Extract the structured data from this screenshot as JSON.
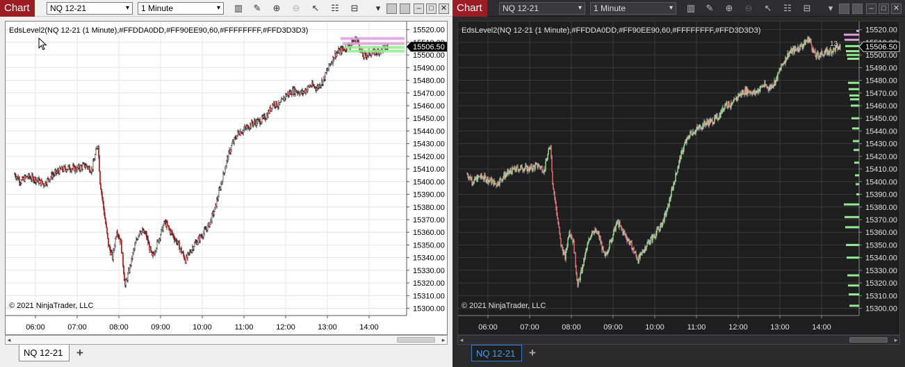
{
  "windows": [
    {
      "id": "light",
      "theme": "light",
      "toolbar": {
        "chart_label": "Chart",
        "instrument": "NQ 12-21",
        "interval": "1 Minute",
        "icons": [
          "bar-type-icon",
          "draw-pencil-icon",
          "zoom-in-icon",
          "zoom-out-icon",
          "pointer-icon",
          "strategies-icon",
          "properties-icon",
          "dropdown-more-icon"
        ]
      },
      "indicator_label": "EdsLevel2(NQ 12-21 (1 Minute),#FFDDA0DD,#FF90EE90,60,#FFFFFFFF,#FFD3D3D3)",
      "copyright": "© 2021 NinjaTrader, LLC",
      "tab_label": "NQ 12-21",
      "add_tab": "+",
      "current_price": "15506.50"
    },
    {
      "id": "dark",
      "theme": "dark",
      "toolbar": {
        "chart_label": "Chart",
        "instrument": "NQ 12-21",
        "interval": "1 Minute"
      },
      "indicator_label": "EdsLevel2(NQ 12-21 (1 Minute),#FFDDA0DD,#FF90EE90,60,#FFFFFFFF,#FFD3D3D3)",
      "copyright": "© 2021 NinjaTrader, LLC",
      "tab_label": "NQ 12-21",
      "add_tab": "+",
      "current_price": "15506.50",
      "volume_label": "13"
    }
  ],
  "chart_data": {
    "type": "candlestick",
    "instrument": "NQ 12-21",
    "interval": "1 Minute",
    "x_ticks": [
      "06:00",
      "07:00",
      "08:00",
      "09:00",
      "10:00",
      "11:00",
      "12:00",
      "13:00",
      "14:00"
    ],
    "y_ticks": [
      "15520.00",
      "15510.00",
      "15500.00",
      "15490.00",
      "15480.00",
      "15470.00",
      "15460.00",
      "15450.00",
      "15440.00",
      "15430.00",
      "15420.00",
      "15410.00",
      "15400.00",
      "15390.00",
      "15380.00",
      "15370.00",
      "15360.00",
      "15350.00",
      "15340.00",
      "15330.00",
      "15320.00",
      "15310.00",
      "15300.00"
    ],
    "ylim": [
      15297,
      15522
    ],
    "current_price": 15506.5,
    "colors": {
      "up_light": "#ffffff",
      "down_light": "#c41a1a",
      "up_dark": "#90ee90",
      "down_dark": "#ff6b6b",
      "level_buy": "#90ee90",
      "level_sell": "#dda0dd"
    },
    "price_path": [
      [
        5.5,
        15406
      ],
      [
        5.65,
        15400
      ],
      [
        5.8,
        15404
      ],
      [
        6.0,
        15402
      ],
      [
        6.2,
        15398
      ],
      [
        6.4,
        15405
      ],
      [
        6.6,
        15409
      ],
      [
        6.8,
        15411
      ],
      [
        7.0,
        15410
      ],
      [
        7.2,
        15413
      ],
      [
        7.35,
        15409
      ],
      [
        7.5,
        15430
      ],
      [
        7.55,
        15400
      ],
      [
        7.65,
        15375
      ],
      [
        7.75,
        15350
      ],
      [
        7.85,
        15340
      ],
      [
        7.95,
        15362
      ],
      [
        8.05,
        15352
      ],
      [
        8.15,
        15318
      ],
      [
        8.25,
        15330
      ],
      [
        8.35,
        15345
      ],
      [
        8.5,
        15362
      ],
      [
        8.65,
        15358
      ],
      [
        8.8,
        15340
      ],
      [
        8.95,
        15354
      ],
      [
        9.1,
        15368
      ],
      [
        9.25,
        15360
      ],
      [
        9.4,
        15352
      ],
      [
        9.6,
        15338
      ],
      [
        9.8,
        15350
      ],
      [
        10.0,
        15358
      ],
      [
        10.15,
        15365
      ],
      [
        10.3,
        15378
      ],
      [
        10.45,
        15398
      ],
      [
        10.6,
        15418
      ],
      [
        10.7,
        15428
      ],
      [
        10.85,
        15438
      ],
      [
        11.0,
        15441
      ],
      [
        11.2,
        15446
      ],
      [
        11.4,
        15448
      ],
      [
        11.55,
        15452
      ],
      [
        11.7,
        15462
      ],
      [
        11.85,
        15460
      ],
      [
        12.0,
        15468
      ],
      [
        12.2,
        15472
      ],
      [
        12.4,
        15470
      ],
      [
        12.6,
        15476
      ],
      [
        12.75,
        15474
      ],
      [
        12.9,
        15480
      ],
      [
        13.05,
        15492
      ],
      [
        13.2,
        15501
      ],
      [
        13.35,
        15504
      ],
      [
        13.55,
        15508
      ],
      [
        13.7,
        15513
      ],
      [
        13.85,
        15499
      ],
      [
        14.0,
        15501
      ],
      [
        14.2,
        15503
      ],
      [
        14.45,
        15506.5
      ]
    ],
    "level_profile_light": [
      [
        15513,
        "sell"
      ],
      [
        15509,
        "sell"
      ],
      [
        15506,
        "buy"
      ],
      [
        15503,
        "buy"
      ]
    ],
    "level_profile_dark": [
      [
        15519,
        "sell"
      ],
      [
        15516,
        "sell"
      ],
      [
        15512,
        "sell"
      ],
      [
        15507,
        "buy"
      ],
      [
        15503,
        "buy"
      ],
      [
        15500,
        "buy"
      ],
      [
        15497,
        "buy"
      ],
      [
        15478,
        "buy"
      ],
      [
        15473,
        "buy"
      ],
      [
        15468,
        "buy"
      ],
      [
        15465,
        "buy"
      ],
      [
        15460,
        "buy"
      ],
      [
        15450,
        "buy"
      ],
      [
        15442,
        "buy"
      ],
      [
        15432,
        "buy"
      ],
      [
        15425,
        "buy"
      ],
      [
        15415,
        "buy"
      ],
      [
        15405,
        "buy"
      ],
      [
        15398,
        "buy"
      ],
      [
        15390,
        "buy"
      ],
      [
        15382,
        "buy"
      ],
      [
        15372,
        "buy"
      ],
      [
        15364,
        "buy"
      ],
      [
        15350,
        "buy"
      ],
      [
        15340,
        "buy"
      ],
      [
        15326,
        "buy"
      ],
      [
        15318,
        "buy"
      ],
      [
        15311,
        "buy"
      ],
      [
        15302,
        "buy"
      ]
    ]
  }
}
